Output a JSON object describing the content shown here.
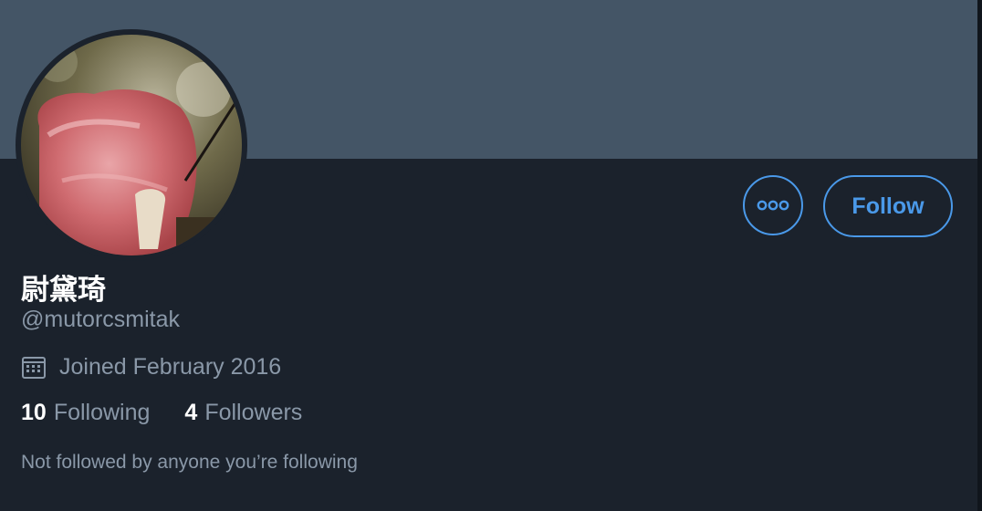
{
  "profile": {
    "display_name": "尉黛琦",
    "handle": "@mutorcsmitak",
    "joined": "Joined February 2016",
    "following_count": "10",
    "following_label": "Following",
    "followers_count": "4",
    "followers_label": "Followers",
    "followed_by_context": "Not followed by anyone you’re following"
  },
  "actions": {
    "follow_label": "Follow",
    "more_icon": "more-dots-icon"
  },
  "icons": {
    "calendar": "calendar-icon"
  },
  "colors": {
    "background": "#1b222c",
    "banner": "#445566",
    "accent": "#4a99e9",
    "secondary_text": "#8a98a8",
    "primary_text": "#ffffff"
  }
}
